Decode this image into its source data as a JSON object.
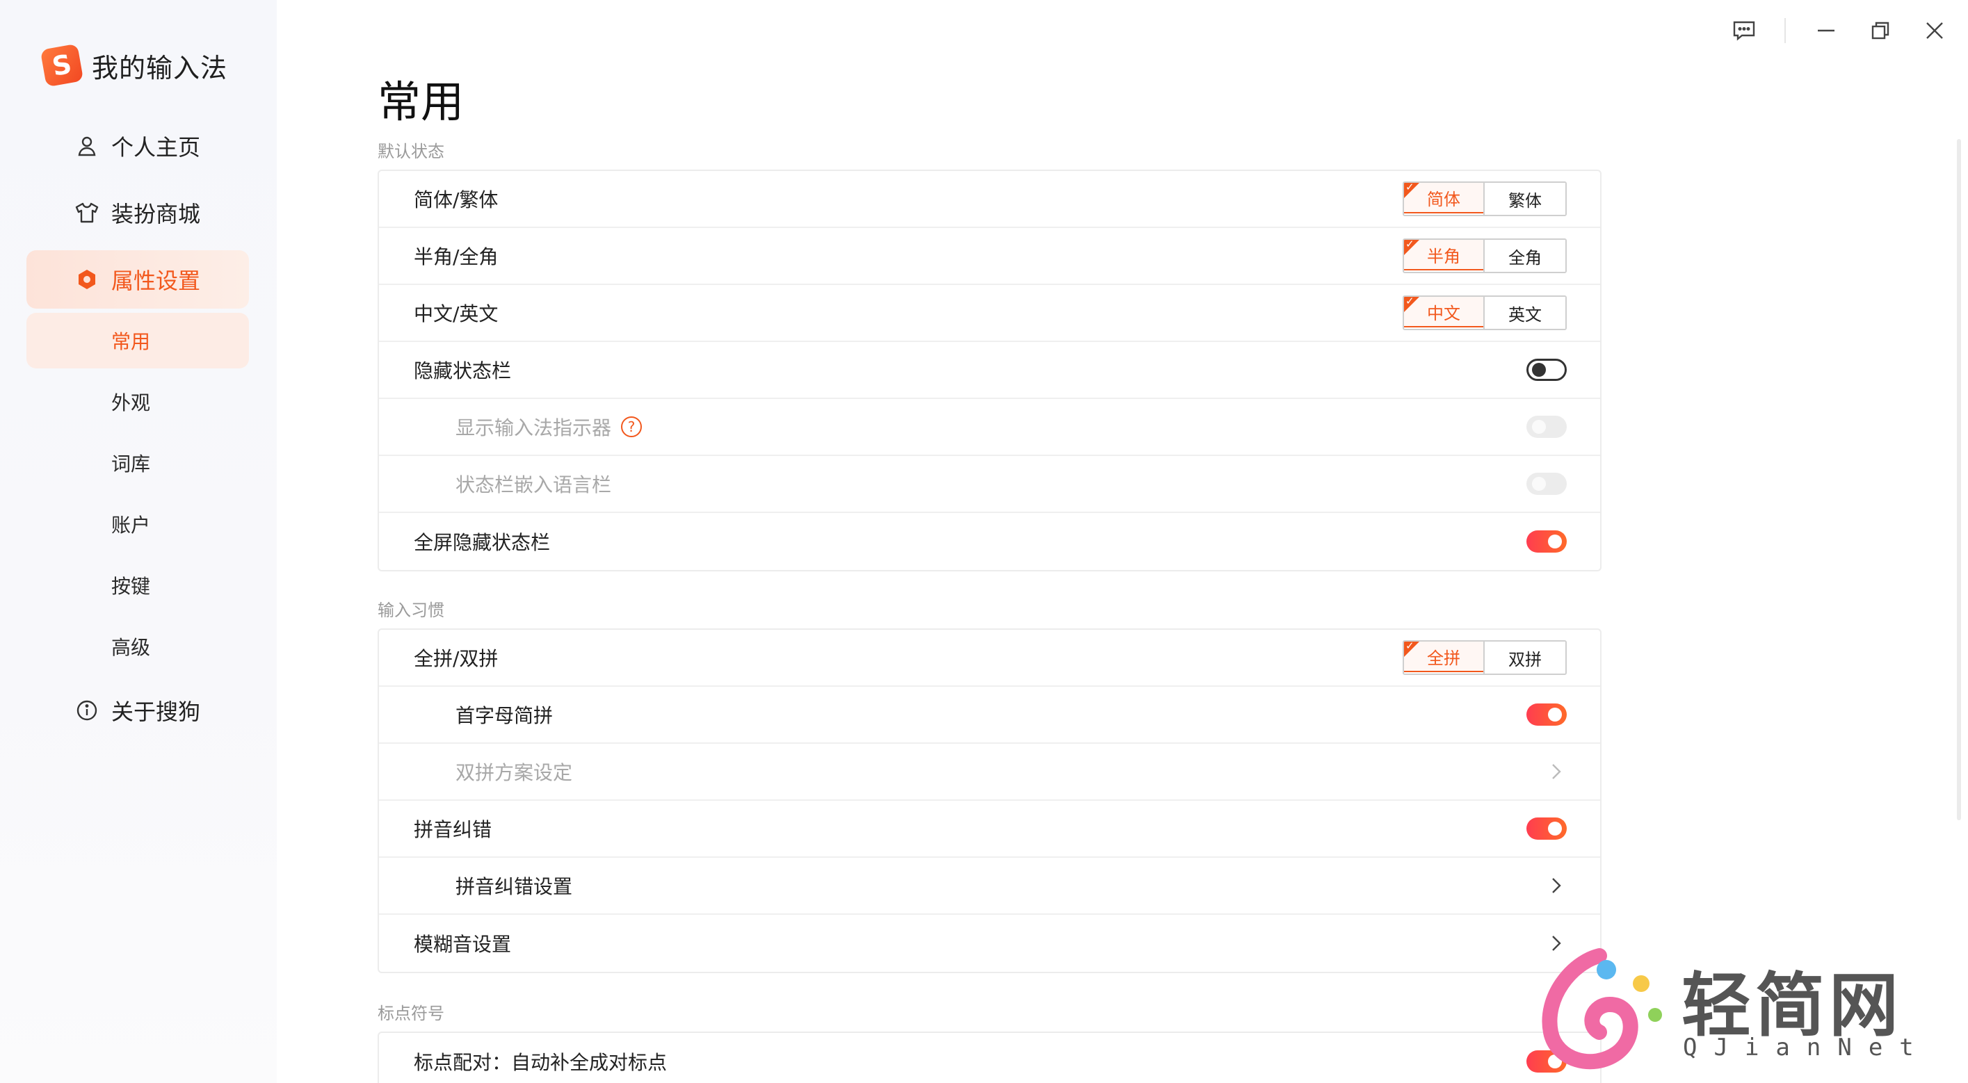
{
  "app": {
    "name": "我的输入法"
  },
  "nav": {
    "home": "个人主页",
    "store": "装扮商城",
    "settings": "属性设置",
    "sub": [
      "常用",
      "外观",
      "词库",
      "账户",
      "按键",
      "高级"
    ],
    "about": "关于搜狗"
  },
  "page": {
    "title": "常用"
  },
  "sections": {
    "default_state": {
      "label": "默认状态",
      "simp_trad": {
        "label": "简体/繁体",
        "options": [
          "简体",
          "繁体"
        ],
        "selected": "简体"
      },
      "half_full": {
        "label": "半角/全角",
        "options": [
          "半角",
          "全角"
        ],
        "selected": "半角"
      },
      "cn_en": {
        "label": "中文/英文",
        "options": [
          "中文",
          "英文"
        ],
        "selected": "中文"
      },
      "hide_status_bar": {
        "label": "隐藏状态栏",
        "state": "off"
      },
      "show_indicator": {
        "label": "显示输入法指示器",
        "state": "disabled"
      },
      "embed_lang_bar": {
        "label": "状态栏嵌入语言栏",
        "state": "disabled"
      },
      "fullscreen_hide": {
        "label": "全屏隐藏状态栏",
        "state": "on"
      }
    },
    "input_habit": {
      "label": "输入习惯",
      "full_double": {
        "label": "全拼/双拼",
        "options": [
          "全拼",
          "双拼"
        ],
        "selected": "全拼"
      },
      "initial_abbrev": {
        "label": "首字母简拼",
        "state": "on"
      },
      "double_scheme": {
        "label": "双拼方案设定"
      },
      "pinyin_correct": {
        "label": "拼音纠错",
        "state": "on"
      },
      "pinyin_correct_settings": {
        "label": "拼音纠错设置"
      },
      "fuzzy": {
        "label": "模糊音设置"
      }
    },
    "punctuation": {
      "label": "标点符号",
      "pairing": {
        "label": "标点配对：自动补全成对标点",
        "state": "on"
      }
    }
  },
  "watermark": {
    "text": "轻简网",
    "sub": "QJianNet"
  },
  "colors": {
    "accent": "#f2581d",
    "toggle_on": "#ff4a40"
  }
}
